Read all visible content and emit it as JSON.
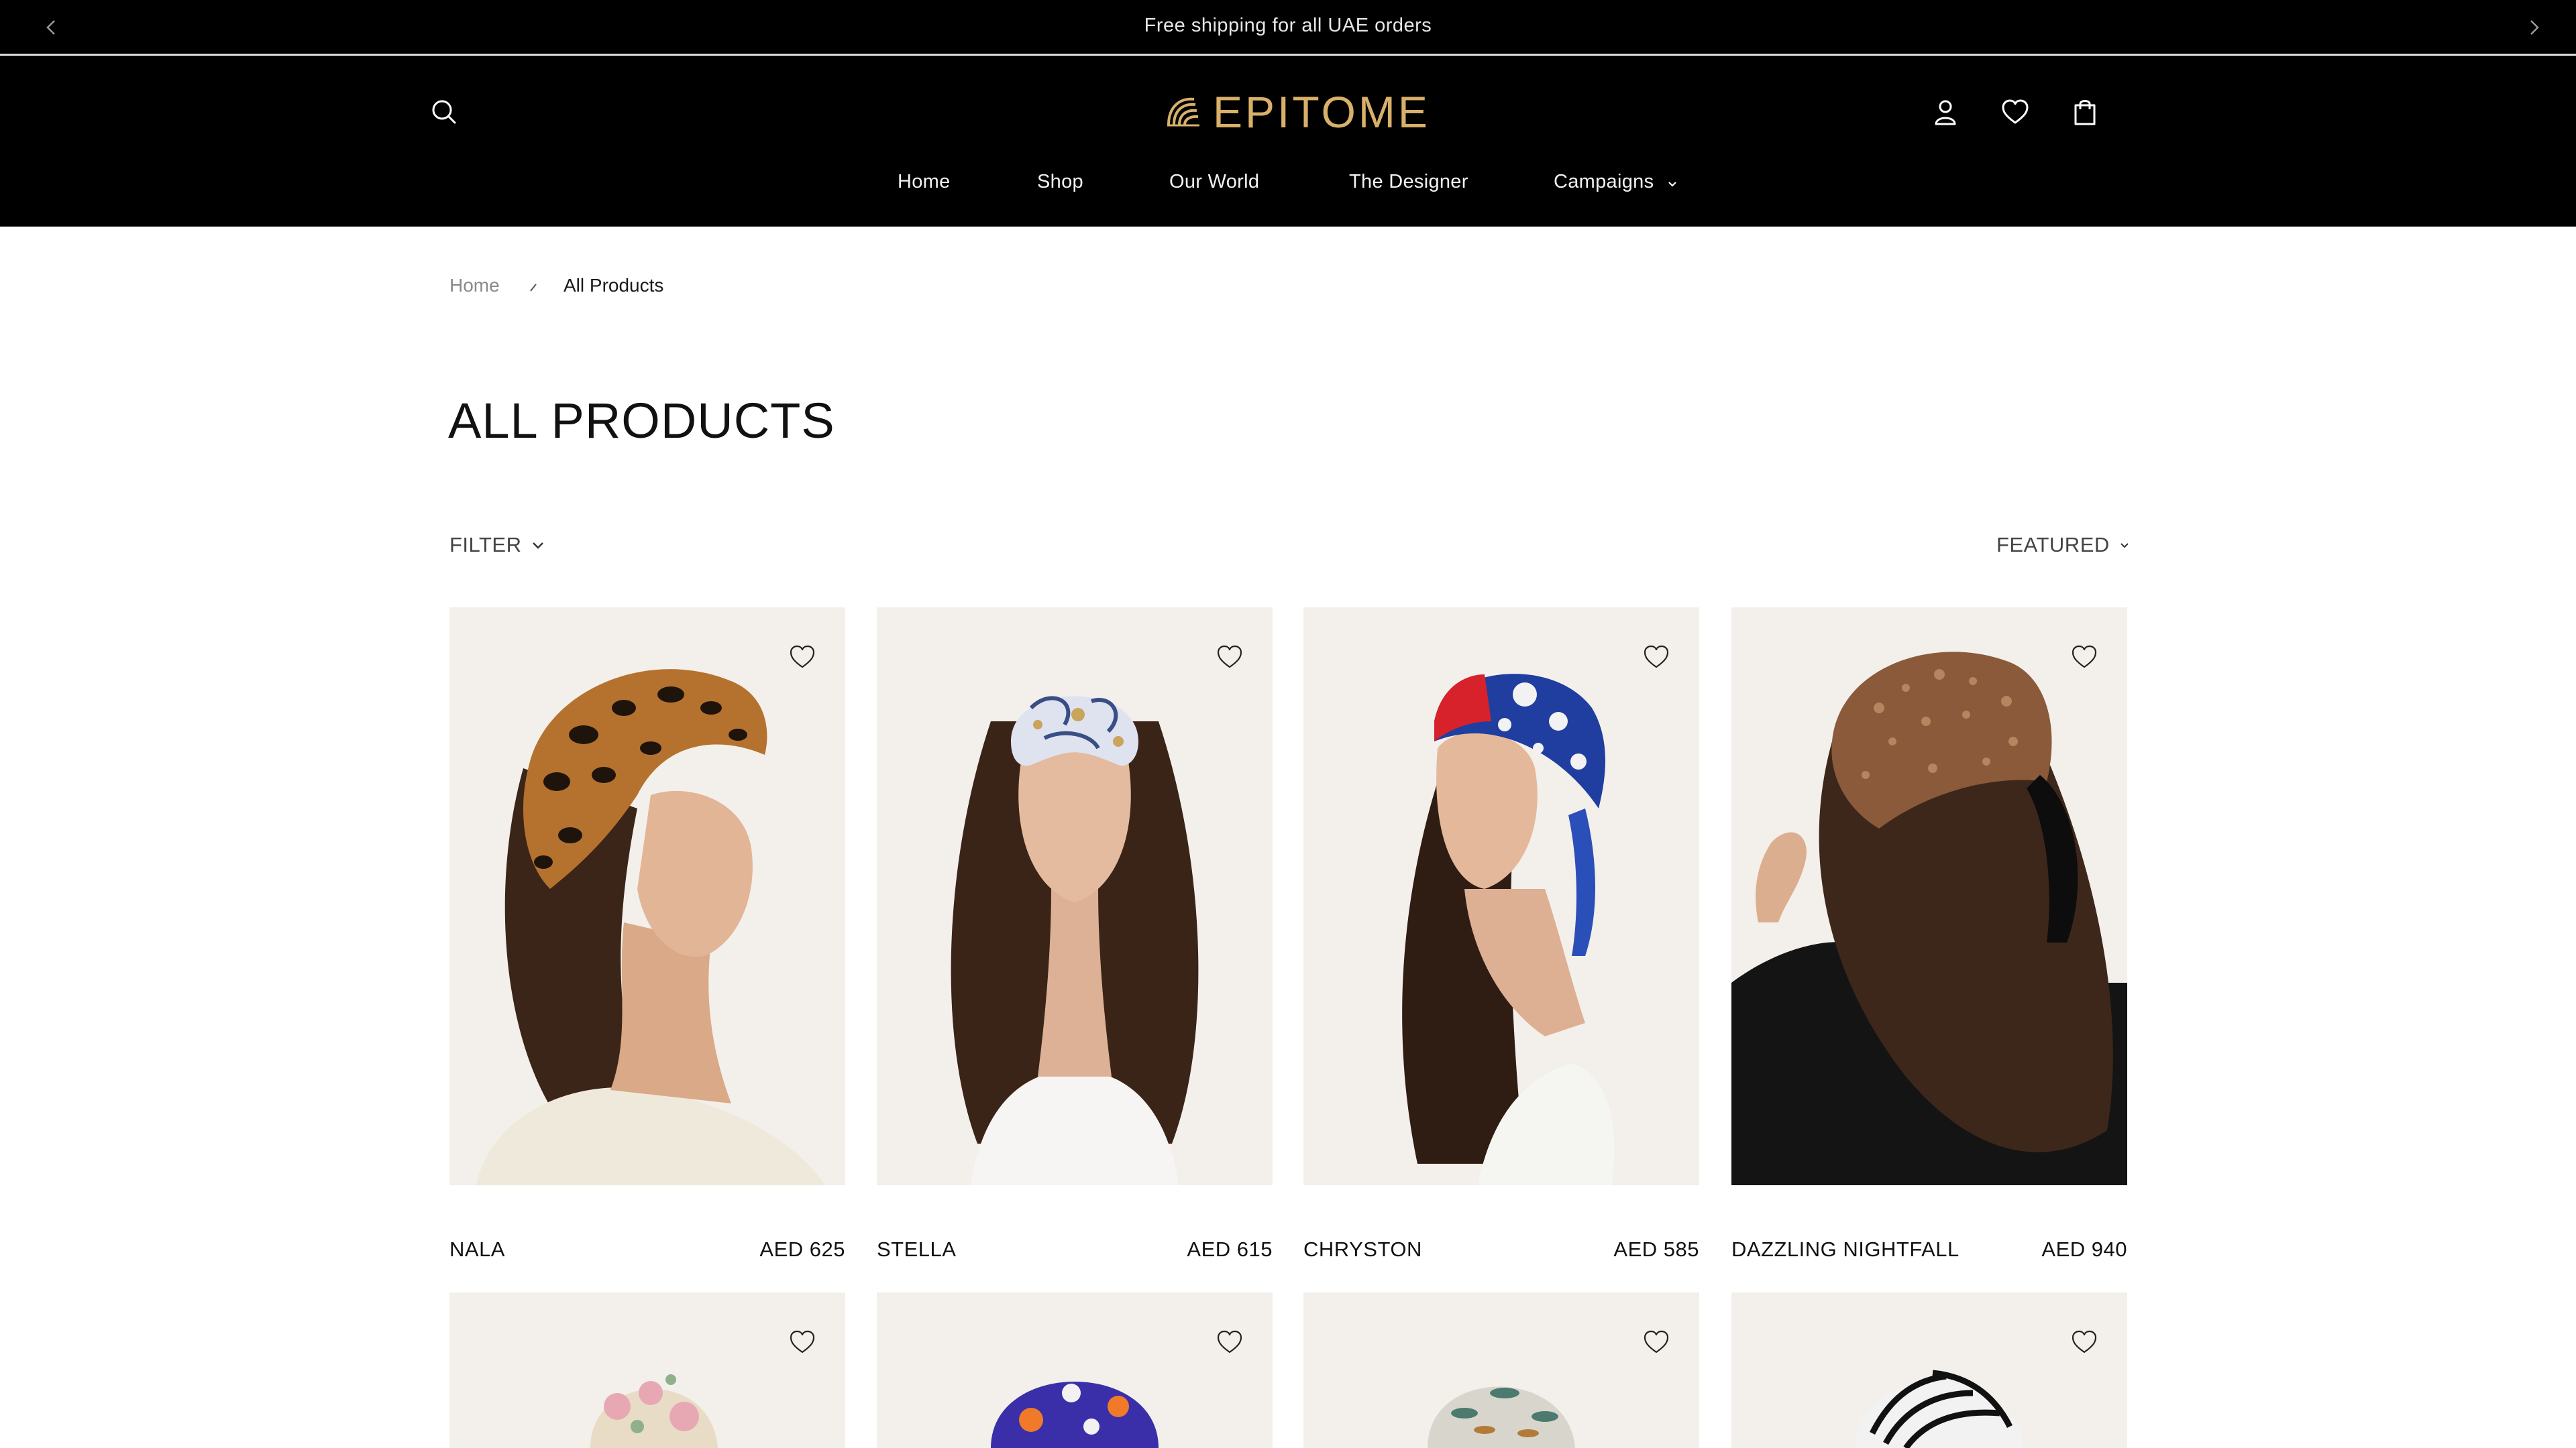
{
  "announcement": {
    "text": "Free shipping for all UAE orders"
  },
  "brand": {
    "name": "EPITOME",
    "gold": "#d8b06a"
  },
  "header_icons": [
    "search-icon",
    "user-icon",
    "heart-icon",
    "shopping-bag-icon"
  ],
  "nav": {
    "home": "Home",
    "shop": "Shop",
    "our_world": "Our World",
    "the_designer": "The Designer",
    "campaigns": "Campaigns"
  },
  "breadcrumb": {
    "home": "Home",
    "current": "All Products"
  },
  "page": {
    "title": "ALL PRODUCTS"
  },
  "toolbar": {
    "filter": "FILTER",
    "sort": "FEATURED"
  },
  "products": [
    {
      "name": "NALA",
      "price": "AED 625"
    },
    {
      "name": "STELLA",
      "price": "AED 615"
    },
    {
      "name": "CHRYSTON",
      "price": "AED 585"
    },
    {
      "name": "DAZZLING NIGHTFALL",
      "price": "AED 940"
    },
    {
      "name": "",
      "price": ""
    },
    {
      "name": "",
      "price": ""
    },
    {
      "name": "",
      "price": ""
    },
    {
      "name": "",
      "price": ""
    }
  ]
}
